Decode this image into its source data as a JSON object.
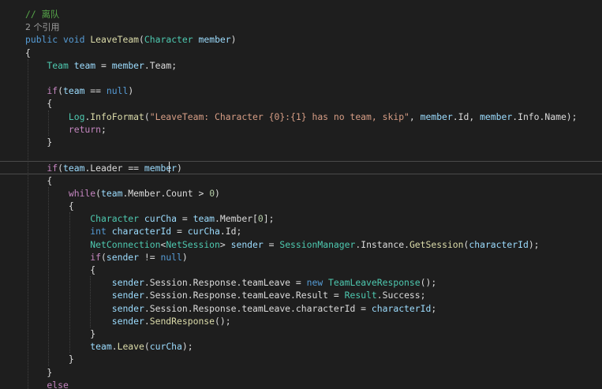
{
  "editor": {
    "code_lines": [
      [
        {
          "t": "// 离队",
          "c": "cmt"
        }
      ],
      [
        {
          "t": "2 个引用",
          "c": "ref"
        }
      ],
      [
        {
          "t": "public",
          "c": "kw"
        },
        {
          "t": " ",
          "c": "punc"
        },
        {
          "t": "void",
          "c": "kw"
        },
        {
          "t": " ",
          "c": "punc"
        },
        {
          "t": "LeaveTeam",
          "c": "fn"
        },
        {
          "t": "(",
          "c": "punc"
        },
        {
          "t": "Character",
          "c": "type"
        },
        {
          "t": " ",
          "c": "punc"
        },
        {
          "t": "member",
          "c": "var"
        },
        {
          "t": ")",
          "c": "punc"
        }
      ],
      [
        {
          "t": "{",
          "c": "punc"
        }
      ],
      [
        {
          "t": "    Team",
          "c": "type"
        },
        {
          "t": " ",
          "c": "punc"
        },
        {
          "t": "team",
          "c": "var"
        },
        {
          "t": " = ",
          "c": "punc"
        },
        {
          "t": "member",
          "c": "var"
        },
        {
          "t": ".Team;",
          "c": "punc"
        }
      ],
      [
        {
          "t": "",
          "c": "punc"
        }
      ],
      [
        {
          "t": "    if",
          "c": "ctl"
        },
        {
          "t": "(",
          "c": "punc"
        },
        {
          "t": "team",
          "c": "var"
        },
        {
          "t": " == ",
          "c": "punc"
        },
        {
          "t": "null",
          "c": "kw"
        },
        {
          "t": ")",
          "c": "punc"
        }
      ],
      [
        {
          "t": "    {",
          "c": "punc"
        }
      ],
      [
        {
          "t": "        Log",
          "c": "type"
        },
        {
          "t": ".",
          "c": "punc"
        },
        {
          "t": "InfoFormat",
          "c": "fn"
        },
        {
          "t": "(",
          "c": "punc"
        },
        {
          "t": "\"LeaveTeam: Character {0}:{1} has no team, skip\"",
          "c": "str"
        },
        {
          "t": ", ",
          "c": "punc"
        },
        {
          "t": "member",
          "c": "var"
        },
        {
          "t": ".Id, ",
          "c": "punc"
        },
        {
          "t": "member",
          "c": "var"
        },
        {
          "t": ".Info.Name);",
          "c": "punc"
        }
      ],
      [
        {
          "t": "        return",
          "c": "ctl"
        },
        {
          "t": ";",
          "c": "punc"
        }
      ],
      [
        {
          "t": "    }",
          "c": "punc"
        }
      ],
      [
        {
          "t": "",
          "c": "punc"
        }
      ],
      [
        {
          "t": "    if",
          "c": "ctl"
        },
        {
          "t": "(",
          "c": "punc"
        },
        {
          "t": "team",
          "c": "var"
        },
        {
          "t": ".Leader == ",
          "c": "punc"
        },
        {
          "t": "member",
          "c": "var"
        },
        {
          "t": ")",
          "c": "punc"
        }
      ],
      [
        {
          "t": "    {",
          "c": "punc"
        }
      ],
      [
        {
          "t": "        while",
          "c": "ctl"
        },
        {
          "t": "(",
          "c": "punc"
        },
        {
          "t": "team",
          "c": "var"
        },
        {
          "t": ".Member.Count > ",
          "c": "punc"
        },
        {
          "t": "0",
          "c": "num"
        },
        {
          "t": ")",
          "c": "punc"
        }
      ],
      [
        {
          "t": "        {",
          "c": "punc"
        }
      ],
      [
        {
          "t": "            Character",
          "c": "type"
        },
        {
          "t": " ",
          "c": "punc"
        },
        {
          "t": "curCha",
          "c": "var"
        },
        {
          "t": " = ",
          "c": "punc"
        },
        {
          "t": "team",
          "c": "var"
        },
        {
          "t": ".Member[",
          "c": "punc"
        },
        {
          "t": "0",
          "c": "num"
        },
        {
          "t": "];",
          "c": "punc"
        }
      ],
      [
        {
          "t": "            int",
          "c": "kw"
        },
        {
          "t": " ",
          "c": "punc"
        },
        {
          "t": "characterId",
          "c": "var"
        },
        {
          "t": " = ",
          "c": "punc"
        },
        {
          "t": "curCha",
          "c": "var"
        },
        {
          "t": ".Id;",
          "c": "punc"
        }
      ],
      [
        {
          "t": "            NetConnection",
          "c": "type"
        },
        {
          "t": "<",
          "c": "punc"
        },
        {
          "t": "NetSession",
          "c": "type"
        },
        {
          "t": "> ",
          "c": "punc"
        },
        {
          "t": "sender",
          "c": "var"
        },
        {
          "t": " = ",
          "c": "punc"
        },
        {
          "t": "SessionManager",
          "c": "type"
        },
        {
          "t": ".Instance.",
          "c": "punc"
        },
        {
          "t": "GetSession",
          "c": "fn"
        },
        {
          "t": "(",
          "c": "punc"
        },
        {
          "t": "characterId",
          "c": "var"
        },
        {
          "t": ");",
          "c": "punc"
        }
      ],
      [
        {
          "t": "            if",
          "c": "ctl"
        },
        {
          "t": "(",
          "c": "punc"
        },
        {
          "t": "sender",
          "c": "var"
        },
        {
          "t": " != ",
          "c": "punc"
        },
        {
          "t": "null",
          "c": "kw"
        },
        {
          "t": ")",
          "c": "punc"
        }
      ],
      [
        {
          "t": "            {",
          "c": "punc"
        }
      ],
      [
        {
          "t": "                sender",
          "c": "var"
        },
        {
          "t": ".Session.Response.teamLeave = ",
          "c": "punc"
        },
        {
          "t": "new",
          "c": "kw"
        },
        {
          "t": " ",
          "c": "punc"
        },
        {
          "t": "TeamLeaveResponse",
          "c": "type"
        },
        {
          "t": "();",
          "c": "punc"
        }
      ],
      [
        {
          "t": "                sender",
          "c": "var"
        },
        {
          "t": ".Session.Response.teamLeave.Result = ",
          "c": "punc"
        },
        {
          "t": "Result",
          "c": "type"
        },
        {
          "t": ".Success;",
          "c": "punc"
        }
      ],
      [
        {
          "t": "                sender",
          "c": "var"
        },
        {
          "t": ".Session.Response.teamLeave.characterId = ",
          "c": "punc"
        },
        {
          "t": "characterId",
          "c": "var"
        },
        {
          "t": ";",
          "c": "punc"
        }
      ],
      [
        {
          "t": "                sender",
          "c": "var"
        },
        {
          "t": ".",
          "c": "punc"
        },
        {
          "t": "SendResponse",
          "c": "fn"
        },
        {
          "t": "();",
          "c": "punc"
        }
      ],
      [
        {
          "t": "            }",
          "c": "punc"
        }
      ],
      [
        {
          "t": "            team",
          "c": "var"
        },
        {
          "t": ".",
          "c": "punc"
        },
        {
          "t": "Leave",
          "c": "fn"
        },
        {
          "t": "(",
          "c": "punc"
        },
        {
          "t": "curCha",
          "c": "var"
        },
        {
          "t": ");",
          "c": "punc"
        }
      ],
      [
        {
          "t": "        }",
          "c": "punc"
        }
      ],
      [
        {
          "t": "    }",
          "c": "punc"
        }
      ],
      [
        {
          "t": "    else",
          "c": "ctl"
        }
      ]
    ]
  }
}
